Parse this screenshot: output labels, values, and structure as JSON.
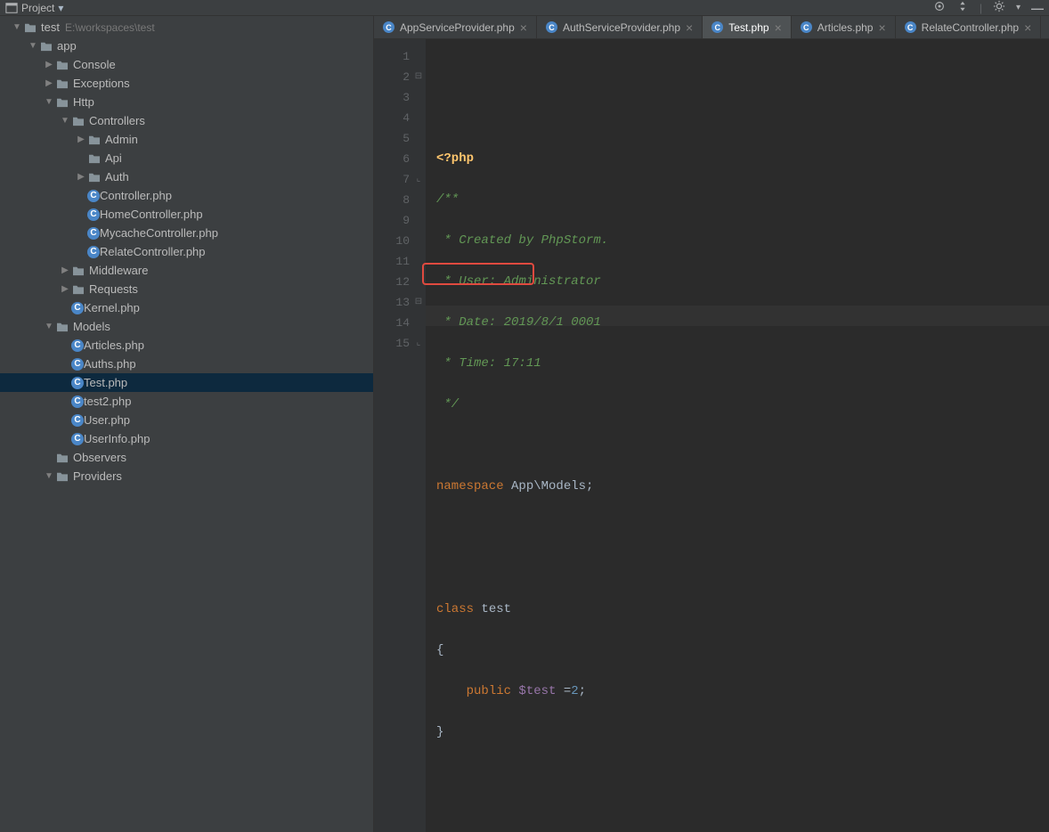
{
  "toolbar": {
    "project_label": "Project",
    "icons": [
      "target",
      "sort",
      "filter",
      "collapse"
    ]
  },
  "tree": [
    {
      "d": 0,
      "exp": true,
      "type": "root",
      "label": "test",
      "extra": "E:\\workspaces\\test"
    },
    {
      "d": 1,
      "exp": true,
      "type": "folder",
      "label": "app"
    },
    {
      "d": 2,
      "exp": false,
      "type": "folder",
      "label": "Console",
      "arrow": true
    },
    {
      "d": 2,
      "exp": false,
      "type": "folder",
      "label": "Exceptions",
      "arrow": true
    },
    {
      "d": 2,
      "exp": true,
      "type": "folder",
      "label": "Http"
    },
    {
      "d": 3,
      "exp": true,
      "type": "folder",
      "label": "Controllers"
    },
    {
      "d": 4,
      "exp": false,
      "type": "folder",
      "label": "Admin",
      "arrow": true
    },
    {
      "d": 4,
      "exp": false,
      "type": "folder",
      "label": "Api"
    },
    {
      "d": 4,
      "exp": false,
      "type": "folder",
      "label": "Auth",
      "arrow": true
    },
    {
      "d": 4,
      "exp": false,
      "type": "class",
      "label": "Controller.php"
    },
    {
      "d": 4,
      "exp": false,
      "type": "class",
      "label": "HomeController.php"
    },
    {
      "d": 4,
      "exp": false,
      "type": "class",
      "label": "MycacheController.php"
    },
    {
      "d": 4,
      "exp": false,
      "type": "class",
      "label": "RelateController.php"
    },
    {
      "d": 3,
      "exp": false,
      "type": "folder",
      "label": "Middleware",
      "arrow": true
    },
    {
      "d": 3,
      "exp": false,
      "type": "folder",
      "label": "Requests",
      "arrow": true
    },
    {
      "d": 3,
      "exp": false,
      "type": "class",
      "label": "Kernel.php"
    },
    {
      "d": 2,
      "exp": true,
      "type": "folder",
      "label": "Models"
    },
    {
      "d": 3,
      "exp": false,
      "type": "class",
      "label": "Articles.php"
    },
    {
      "d": 3,
      "exp": false,
      "type": "class",
      "label": "Auths.php"
    },
    {
      "d": 3,
      "exp": false,
      "type": "class",
      "label": "Test.php",
      "selected": true
    },
    {
      "d": 3,
      "exp": false,
      "type": "class",
      "label": "test2.php"
    },
    {
      "d": 3,
      "exp": false,
      "type": "class",
      "label": "User.php"
    },
    {
      "d": 3,
      "exp": false,
      "type": "class",
      "label": "UserInfo.php"
    },
    {
      "d": 2,
      "exp": false,
      "type": "folder",
      "label": "Observers"
    },
    {
      "d": 2,
      "exp": true,
      "type": "folder",
      "label": "Providers"
    }
  ],
  "tabs": [
    {
      "label": "AppServiceProvider.php",
      "active": false
    },
    {
      "label": "AuthServiceProvider.php",
      "active": false
    },
    {
      "label": "Test.php",
      "active": true
    },
    {
      "label": "Articles.php",
      "active": false
    },
    {
      "label": "RelateController.php",
      "active": false
    }
  ],
  "code": {
    "lines": 15,
    "hl_line": 14,
    "content": {
      "l1": "<?php",
      "l2": "/**",
      "l3": " * Created by PhpStorm.",
      "l4": " * User: Administrator",
      "l5": " * Date: 2019/8/1 0001",
      "l6": " * Time: 17:11",
      "l7": " */",
      "l8": "",
      "l9a": "namespace",
      "l9b": " App\\Models;",
      "l10": "",
      "l11": "",
      "l12a": "class",
      "l12b": " test",
      "l13": "{",
      "l14a": "    ",
      "l14b": "public",
      "l14c": " $test ",
      "l14d": "=",
      "l14e": "2",
      "l14f": ";",
      "l15": "}"
    }
  }
}
